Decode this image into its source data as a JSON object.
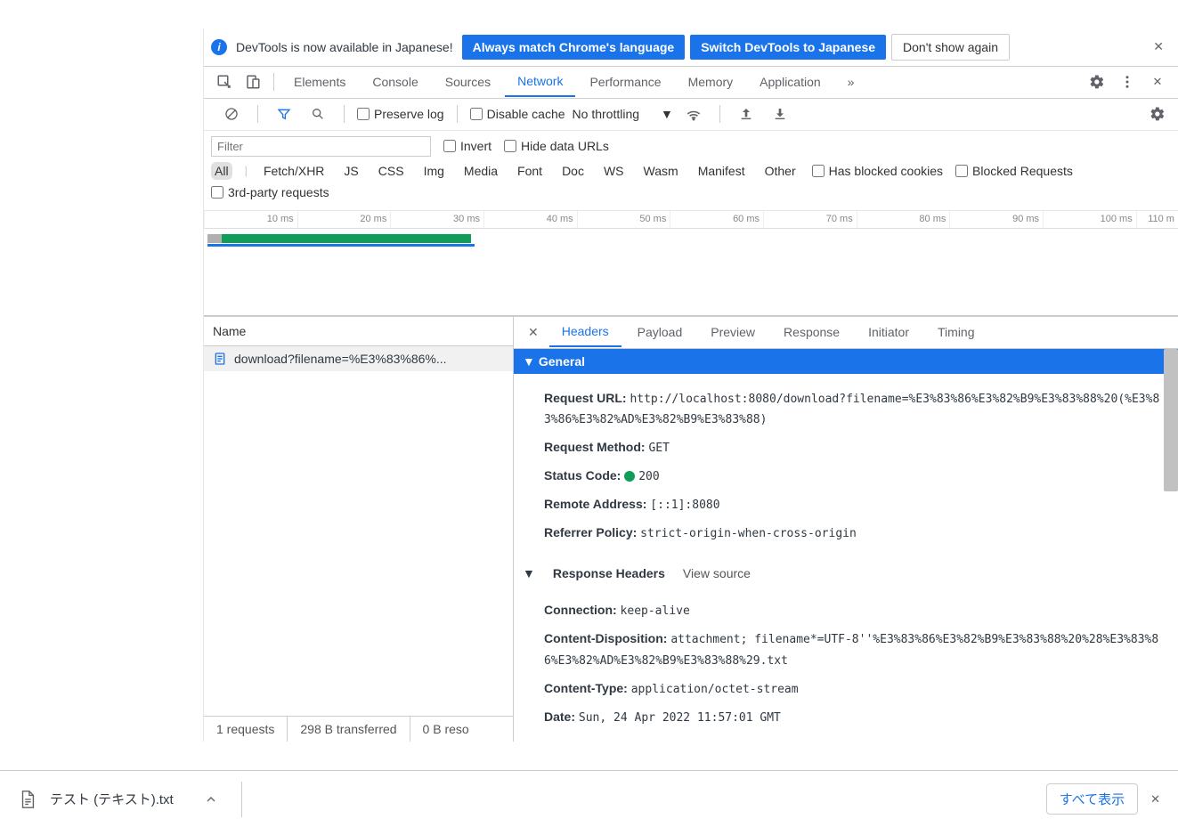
{
  "infobar": {
    "text": "DevTools is now available in Japanese!",
    "btn1": "Always match Chrome's language",
    "btn2": "Switch DevTools to Japanese",
    "btn3": "Don't show again"
  },
  "tabs": {
    "elements": "Elements",
    "console": "Console",
    "sources": "Sources",
    "network": "Network",
    "performance": "Performance",
    "memory": "Memory",
    "application": "Application",
    "more": "»"
  },
  "toolbar": {
    "preserve_log": "Preserve log",
    "disable_cache": "Disable cache",
    "throttling": "No throttling"
  },
  "filter": {
    "placeholder": "Filter",
    "invert": "Invert",
    "hide_data_urls": "Hide data URLs",
    "types": [
      "All",
      "Fetch/XHR",
      "JS",
      "CSS",
      "Img",
      "Media",
      "Font",
      "Doc",
      "WS",
      "Wasm",
      "Manifest",
      "Other"
    ],
    "has_blocked": "Has blocked cookies",
    "blocked_req": "Blocked Requests",
    "third_party": "3rd-party requests"
  },
  "timeline_ticks": [
    "10 ms",
    "20 ms",
    "30 ms",
    "40 ms",
    "50 ms",
    "60 ms",
    "70 ms",
    "80 ms",
    "90 ms",
    "100 ms",
    "110 m"
  ],
  "list": {
    "header": "Name",
    "item": "download?filename=%E3%83%86%..."
  },
  "detail_tabs": {
    "headers": "Headers",
    "payload": "Payload",
    "preview": "Preview",
    "response": "Response",
    "initiator": "Initiator",
    "timing": "Timing"
  },
  "general": {
    "title": "General",
    "request_url_k": "Request URL:",
    "request_url_v": "http://localhost:8080/download?filename=%E3%83%86%E3%82%B9%E3%83%88%20(%E3%83%86%E3%82%AD%E3%82%B9%E3%83%88)",
    "method_k": "Request Method:",
    "method_v": "GET",
    "status_k": "Status Code:",
    "status_v": "200",
    "remote_k": "Remote Address:",
    "remote_v": "[::1]:8080",
    "ref_k": "Referrer Policy:",
    "ref_v": "strict-origin-when-cross-origin"
  },
  "resp_headers": {
    "title": "Response Headers",
    "view_source": "View source",
    "connection_k": "Connection:",
    "connection_v": "keep-alive",
    "cd_k": "Content-Disposition:",
    "cd_v": "attachment; filename*=UTF-8''%E3%83%86%E3%82%B9%E3%83%88%20%28%E3%83%86%E3%82%AD%E3%82%B9%E3%83%88%29.txt",
    "ct_k": "Content-Type:",
    "ct_v": "application/octet-stream",
    "date_k": "Date:",
    "date_v": "Sun, 24 Apr 2022 11:57:01 GMT"
  },
  "status": {
    "requests": "1 requests",
    "transferred": "298 B transferred",
    "resources": "0 B reso"
  },
  "download": {
    "filename": "テスト (テキスト).txt",
    "show_all": "すべて表示"
  }
}
